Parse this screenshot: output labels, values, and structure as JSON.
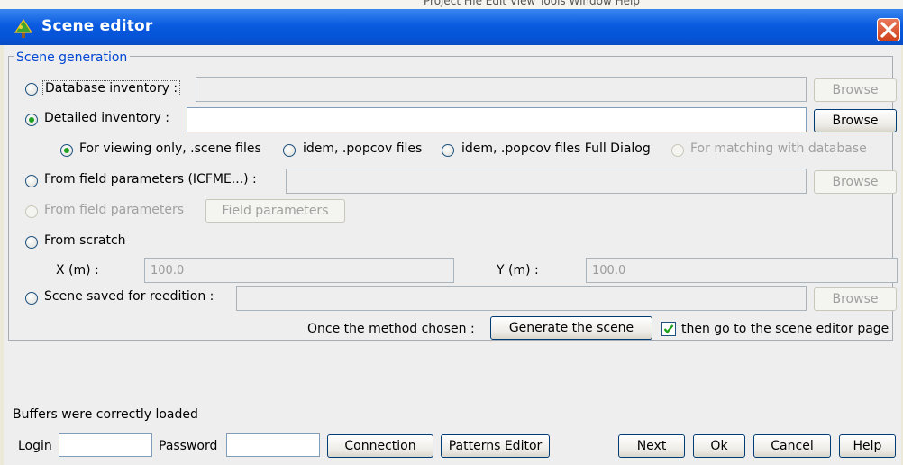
{
  "window": {
    "title": "Scene editor",
    "menubar_fragment": "Project  File  Edit  View  Tools  Window  Help"
  },
  "generation": {
    "legend": "Scene generation",
    "database_inventory": {
      "label": "Database inventory :",
      "value": "",
      "browse": "Browse",
      "selected": false,
      "enabled": false
    },
    "detailed_inventory": {
      "label": "Detailed inventory :",
      "value": "",
      "browse": "Browse",
      "selected": true,
      "enabled": true
    },
    "file_options": [
      {
        "label": "For viewing only, .scene files",
        "selected": true,
        "enabled": true
      },
      {
        "label": "idem, .popcov files",
        "selected": false,
        "enabled": true
      },
      {
        "label": "idem, .popcov files Full Dialog",
        "selected": false,
        "enabled": true
      },
      {
        "label": "For matching with database",
        "selected": false,
        "enabled": false
      }
    ],
    "field_params_icfme": {
      "label": "From field parameters (ICFME...) :",
      "value": "",
      "browse": "Browse"
    },
    "field_params": {
      "label": "From field parameters",
      "button": "Field parameters"
    },
    "from_scratch": {
      "label": "From scratch",
      "x_label": "X (m) :",
      "x_value": "100.0",
      "y_label": "Y (m) :",
      "y_value": "100.0"
    },
    "scene_saved": {
      "label": "Scene saved for reedition :",
      "value": "",
      "browse": "Browse"
    },
    "method_prompt": "Once the method chosen :",
    "generate_button": "Generate the scene",
    "goto_editor": {
      "label": "then go to the scene editor page",
      "checked": true
    }
  },
  "status": "Buffers were correctly loaded",
  "footer": {
    "login_label": "Login",
    "login_value": "",
    "password_label": "Password",
    "password_value": "",
    "connection": "Connection",
    "patterns_editor": "Patterns Editor",
    "next": "Next",
    "ok": "Ok",
    "cancel": "Cancel",
    "help": "Help"
  },
  "colors": {
    "title_bar": "#0553d6",
    "legend_text": "#0046d5",
    "radio_dot": "#21a121",
    "close_button": "#d0401c"
  },
  "icons": [
    "tree-icon",
    "close-icon",
    "check-icon"
  ]
}
